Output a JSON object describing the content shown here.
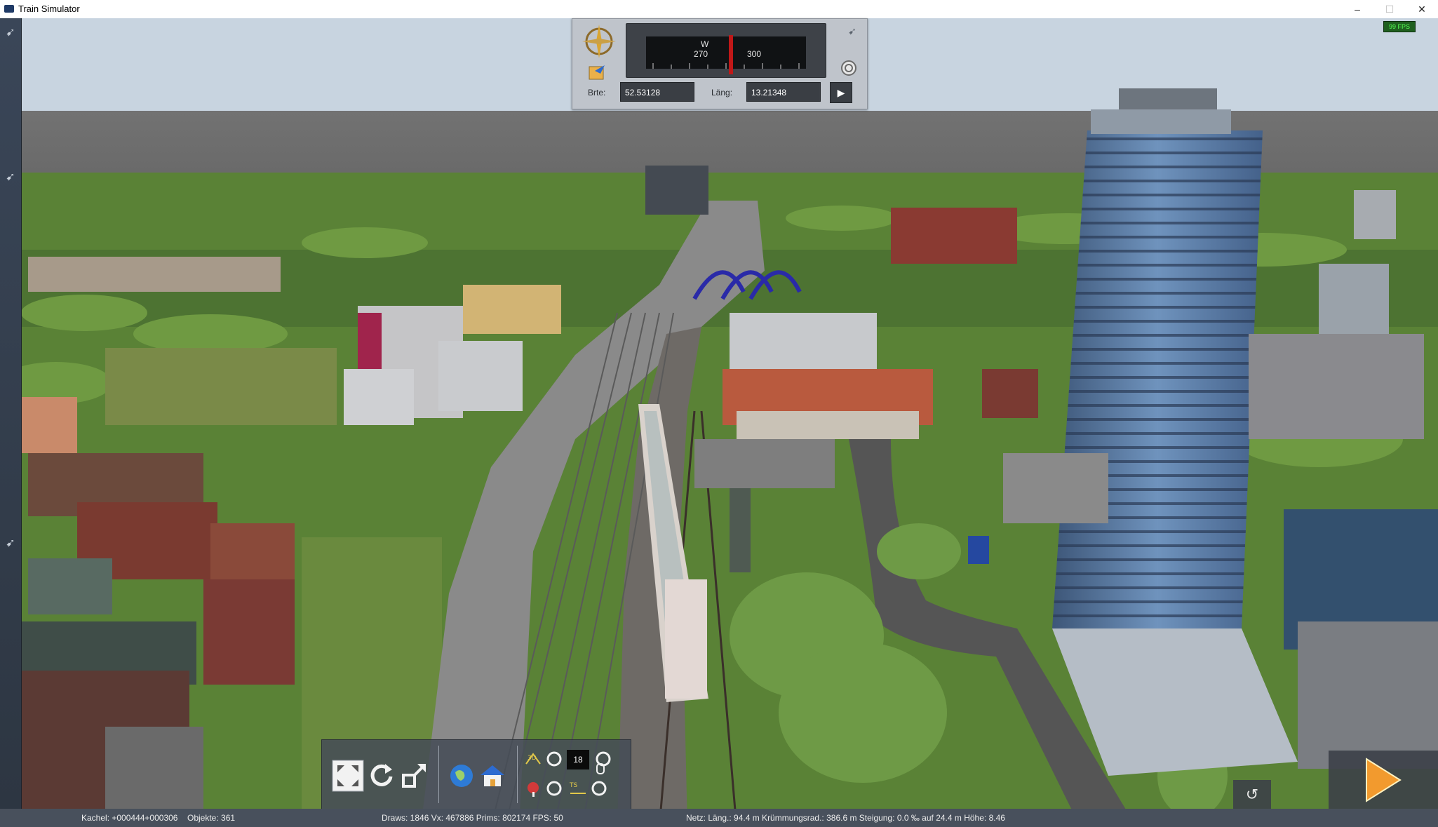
{
  "window": {
    "title": "Train Simulator",
    "minimize": "–",
    "maximize": "☐",
    "close": "✕"
  },
  "hud": {
    "fps_badge": "99 FPS"
  },
  "compass": {
    "heading_cardinal": "W",
    "heading_ticks": [
      "270",
      "300"
    ],
    "lat_label": "Brte:",
    "lat_value": "52.53128",
    "lon_label": "Läng:",
    "lon_value": "13.21348",
    "go_glyph": "▶",
    "icons": [
      "compass-rose-icon",
      "locate-icon",
      "pin-icon",
      "target-icon"
    ]
  },
  "toolbar": {
    "items": [
      "fullscreen-icon",
      "rotate-icon",
      "resize-icon",
      "globe-icon",
      "home-icon",
      "3d-view-icon",
      "radio-icon",
      "signal-icon",
      "hand-icon",
      "lock-icon",
      "ts-icon"
    ],
    "counter": "18"
  },
  "status": {
    "tile": "Kachel: +000444+000306",
    "objects": "Objekte: 361",
    "render": "Draws: 1846 Vx: 467886 Prims: 802174 FPS: 50",
    "network": "Netz:  Läng.:  94.4 m Krümmungsrad.: 386.6 m Steigung:  0.0 ‰ auf 24.4 m Höhe:  8.46"
  },
  "colors": {
    "sky": "#7a7a7a",
    "grass": "#5f8a3a",
    "track": "#7b7b7b",
    "tower_glass": "#5a7ea8",
    "play_accent": "#f29a2e"
  }
}
